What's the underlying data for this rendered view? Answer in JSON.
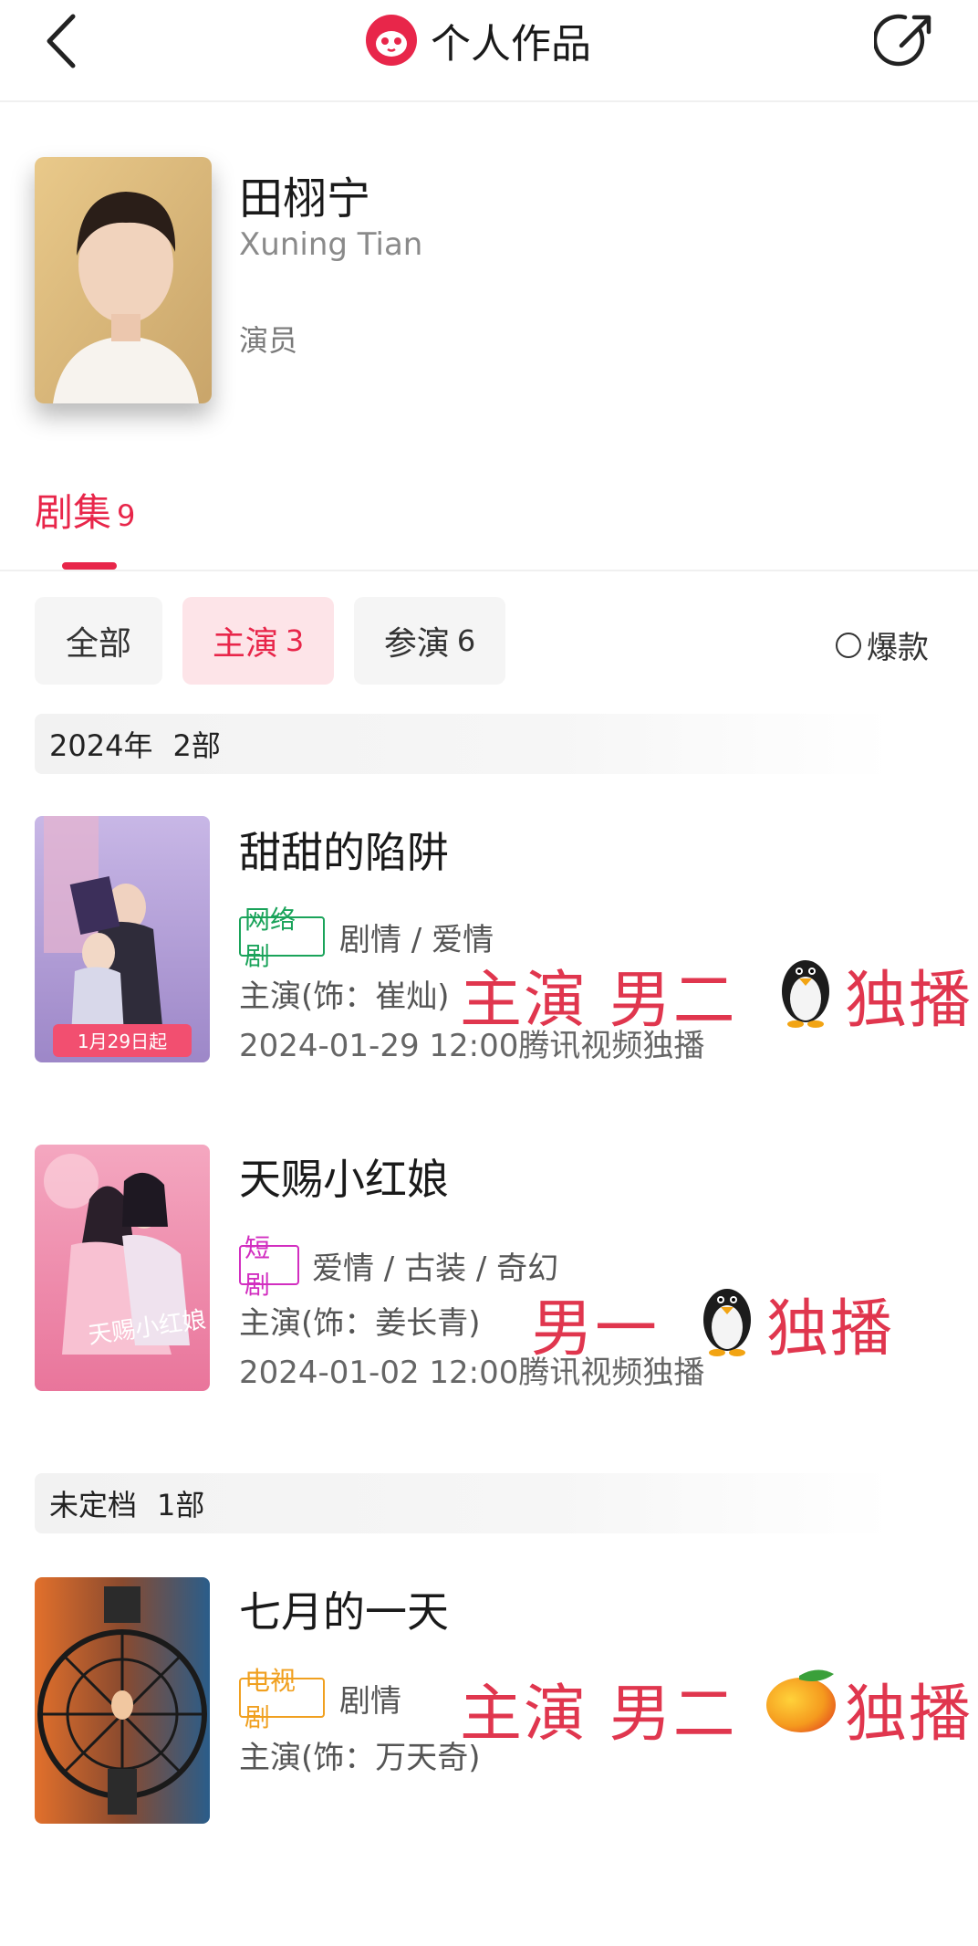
{
  "header": {
    "title": "个人作品"
  },
  "profile": {
    "name": "田栩宁",
    "name_en": "Xuning Tian",
    "role": "演员"
  },
  "tabs": [
    {
      "label": "剧集",
      "count": "9"
    }
  ],
  "filters": [
    {
      "label": "全部",
      "count": ""
    },
    {
      "label": "主演",
      "count": "3"
    },
    {
      "label": "参演",
      "count": "6"
    }
  ],
  "hot_filter": {
    "label": "爆款"
  },
  "groups": [
    {
      "year": "2024年",
      "count": "2部"
    },
    {
      "year": "未定档",
      "count": "1部"
    }
  ],
  "shows": [
    {
      "title": "甜甜的陷阱",
      "badge": "网络剧",
      "badge_color": "#1aa35a",
      "genres": "剧情 / 爱情",
      "role": "主演(饰：崔灿)",
      "date": "2024-01-29 12:00腾讯视频独播",
      "overlay_left": "主演 男二",
      "overlay_right": "独播",
      "platform_icon": "penguin-icon",
      "poster_text": "1月29日起"
    },
    {
      "title": "天赐小红娘",
      "badge": "短剧",
      "badge_color": "#d22ec0",
      "genres": "爱情 / 古装 / 奇幻",
      "role": "主演(饰：姜长青)",
      "date": "2024-01-02 12:00腾讯视频独播",
      "overlay_left": "男一",
      "overlay_right": "独播",
      "platform_icon": "penguin-icon",
      "poster_text": "天赐小红娘"
    },
    {
      "title": "七月的一天",
      "badge": "电视剧",
      "badge_color": "#f0a020",
      "genres": "剧情",
      "role": "主演(饰：万天奇)",
      "date": "",
      "overlay_left": "主演 男二",
      "overlay_right": "独播",
      "platform_icon": "mango-icon",
      "poster_text": ""
    }
  ],
  "colors": {
    "accent": "#e8264a",
    "overlay": "#e0364e"
  }
}
